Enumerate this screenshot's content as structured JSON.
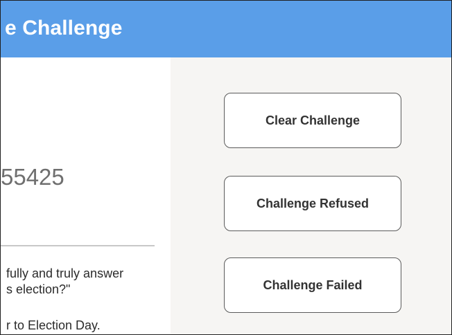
{
  "header": {
    "title": "e Challenge"
  },
  "left": {
    "id_value": "55425",
    "oath_line_1": "fully and truly answer",
    "oath_line_2": "s election?\"",
    "note": "r to Election Day."
  },
  "actions": {
    "clear_label": "Clear Challenge",
    "refused_label": "Challenge Refused",
    "failed_label": "Challenge Failed"
  },
  "colors": {
    "header_bg": "#5a9ee8",
    "panel_bg": "#f6f5f3"
  }
}
